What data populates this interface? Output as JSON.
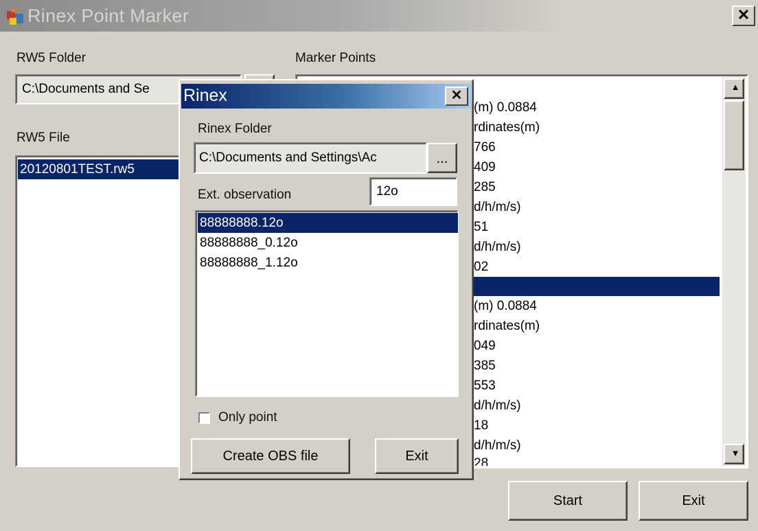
{
  "window": {
    "title": "Rinex Point Marker",
    "close_glyph": "✕"
  },
  "rw5_folder": {
    "label": "RW5 Folder",
    "value": "C:\\Documents and Se",
    "browse_label": "..."
  },
  "rw5_file": {
    "label": "RW5 File",
    "items": [
      "20120801TEST.rw5"
    ],
    "selected_index": 0
  },
  "marker_points": {
    "label": "Marker Points",
    "visible_lines": [
      "(m) 0.0884",
      "rdinates(m)",
      "766",
      "409",
      "285",
      "d/h/m/s)",
      " 51",
      "d/h/m/s)",
      " 02",
      "",
      "(m) 0.0884",
      "rdinates(m)",
      "049",
      "385",
      "553",
      "d/h/m/s)",
      " 18",
      "d/h/m/s)",
      " 28"
    ],
    "selected_line_index": 9
  },
  "main_buttons": {
    "start_label": "Start",
    "exit_label": "Exit"
  },
  "rinex_dialog": {
    "title": "Rinex",
    "close_glyph": "✕",
    "folder_label": "Rinex Folder",
    "folder_value": "C:\\Documents and Settings\\Ac",
    "browse_label": "...",
    "ext_label": "Ext. observation",
    "ext_value": "12o",
    "files": [
      "88888888.12o",
      "88888888_0.12o",
      "88888888_1.12o"
    ],
    "selected_file_index": 0,
    "only_point_label": "Only point",
    "only_point_checked": false,
    "create_label": "Create OBS file",
    "exit_label": "Exit"
  },
  "icons": {
    "app_icon": "app-icon",
    "scroll_up": "▲",
    "scroll_down": "▼"
  },
  "colors": {
    "selection": "#0a246a",
    "dialog_title_start": "#0a246a",
    "dialog_title_end": "#a6caf0",
    "face": "#d4d0c8"
  }
}
